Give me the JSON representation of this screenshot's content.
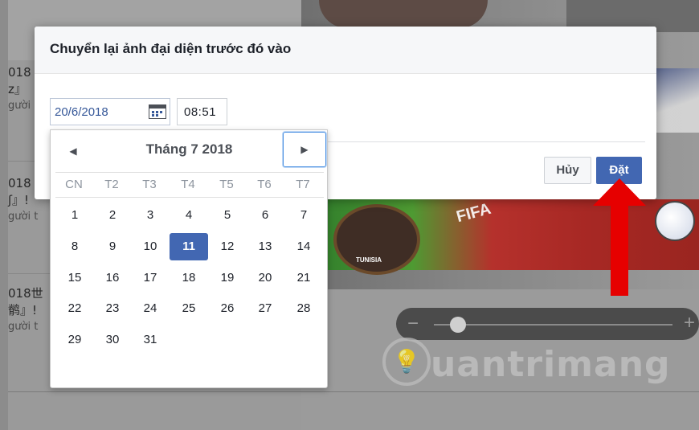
{
  "background": {
    "posts": [
      {
        "line1": "018",
        "line2": "z』",
        "line3": "gười"
      },
      {
        "line1": "018",
        "line2": "ʃ』!",
        "line3": "gười t"
      },
      {
        "line1": "018世",
        "line2": "鹡』!",
        "line3": "gười t"
      }
    ],
    "photo": {
      "badge_text": "TUNISIA",
      "banner_text": "FIFA"
    },
    "zoom_slider": {
      "minus_label": "−",
      "plus_label": "+",
      "level_percent": 10
    },
    "watermark_text": "uantrimang"
  },
  "dialog": {
    "title": "Chuyển lại ảnh đại diện trước đó vào",
    "date_value": "20/6/2018",
    "time_value": "08:51",
    "cancel_label": "Hủy",
    "set_label": "Đặt"
  },
  "calendar": {
    "month_label": "Tháng 7 2018",
    "prev_glyph": "◀",
    "next_glyph": "▶",
    "weekdays": [
      "CN",
      "T2",
      "T3",
      "T4",
      "T5",
      "T6",
      "T7"
    ],
    "weeks": [
      [
        "1",
        "2",
        "3",
        "4",
        "5",
        "6",
        "7"
      ],
      [
        "8",
        "9",
        "10",
        "11",
        "12",
        "13",
        "14"
      ],
      [
        "15",
        "16",
        "17",
        "18",
        "19",
        "20",
        "21"
      ],
      [
        "22",
        "23",
        "24",
        "25",
        "26",
        "27",
        "28"
      ],
      [
        "29",
        "30",
        "31"
      ]
    ],
    "selected_day": "11"
  },
  "colors": {
    "accent": "#4267b2",
    "annotation_arrow": "#e60000"
  }
}
